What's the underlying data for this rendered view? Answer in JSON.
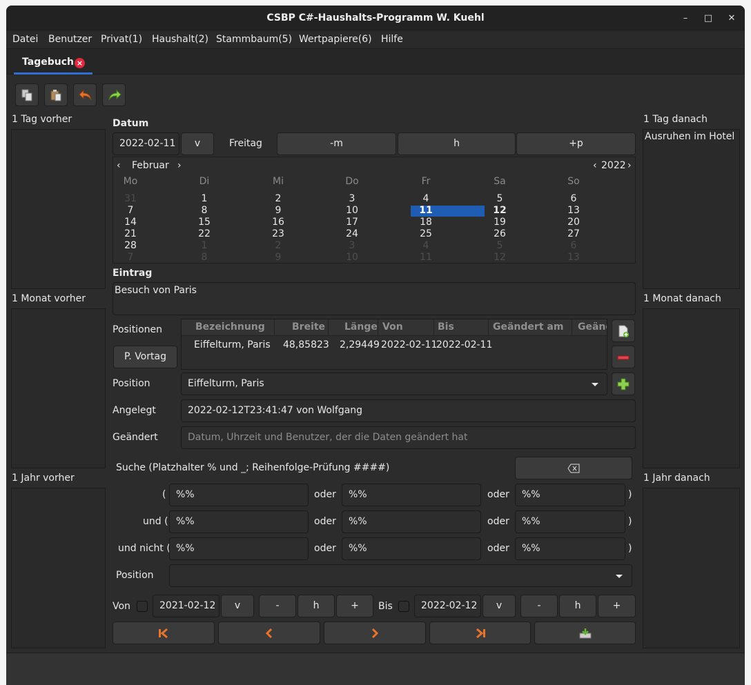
{
  "window": {
    "title": "CSBP C#-Haushalts-Programm W. Kuehl",
    "minimize": "–",
    "maximize": "□",
    "close": "✕"
  },
  "menu": [
    "Datei",
    "Benutzer",
    "Privat(1)",
    "Haushalt(2)",
    "Stammbaum(5)",
    "Wertpapiere(6)",
    "Hilfe"
  ],
  "tab": {
    "label": "Tagebuch",
    "close": "×"
  },
  "toolbar": {
    "icons": [
      "copy-icon",
      "paste-icon",
      "undo-icon",
      "redo-icon"
    ]
  },
  "left": {
    "day_label": "1 Tag vorher",
    "day_text": "",
    "month_label": "1 Monat vorher",
    "month_text": "",
    "year_label": "1 Jahr vorher",
    "year_text": ""
  },
  "right": {
    "day_label": "1 Tag danach",
    "day_text": "Ausruhen im Hotel",
    "month_label": "1 Monat danach",
    "month_text": "",
    "year_label": "1 Jahr danach",
    "year_text": ""
  },
  "datum": {
    "label": "Datum",
    "value": "2022-02-11",
    "v_button": "v",
    "weekday": "Freitag",
    "minus_m": "-m",
    "h_button": "h",
    "plus_p": "+p"
  },
  "calendar": {
    "month": "Februar",
    "year": "2022",
    "prev": "‹",
    "next": "›",
    "weekdays": [
      "Mo",
      "Di",
      "Mi",
      "Do",
      "Fr",
      "Sa",
      "So"
    ],
    "weeks": [
      [
        "31",
        "1",
        "2",
        "3",
        "4",
        "5",
        "6"
      ],
      [
        "7",
        "8",
        "9",
        "10",
        "11",
        "12",
        "13"
      ],
      [
        "14",
        "15",
        "16",
        "17",
        "18",
        "19",
        "20"
      ],
      [
        "21",
        "22",
        "23",
        "24",
        "25",
        "26",
        "27"
      ],
      [
        "28",
        "1",
        "2",
        "3",
        "4",
        "5",
        "6"
      ],
      [
        "7",
        "8",
        "9",
        "10",
        "11",
        "12",
        "13"
      ]
    ],
    "selected": "11",
    "accent": "#1f5db5"
  },
  "eintrag": {
    "label": "Eintrag",
    "value": "Besuch von Paris"
  },
  "positionen": {
    "label": "Positionen",
    "vortag_button": "P. Vortag",
    "columns": [
      "Bezeichnung",
      "Breite",
      "Länge",
      "Von",
      "Bis",
      "Geändert am",
      "Geänd"
    ],
    "rows": [
      [
        "Eiffelturm, Paris",
        "48,85823",
        "2,29449",
        "2022-02-11",
        "2022-02-11",
        "",
        ""
      ]
    ]
  },
  "position": {
    "label": "Position",
    "value": "Eiffelturm, Paris"
  },
  "angelegt": {
    "label": "Angelegt",
    "value": "2022-02-12T23:41:47 von Wolfgang"
  },
  "geaendert": {
    "label": "Geändert",
    "placeholder": "Datum, Uhrzeit und Benutzer, der die Daten geändert hat"
  },
  "suche": {
    "label": "Suche (Platzhalter % und _; Reihenfolge-Prüfung ####)",
    "clear_icon": "backspace-icon",
    "row1_prefix": "(",
    "row2_prefix": "und (",
    "row3_prefix": "und nicht (",
    "oder": "oder",
    "suffix": ")",
    "values": [
      [
        "%%",
        "%%",
        "%%"
      ],
      [
        "%%",
        "%%",
        "%%"
      ],
      [
        "%%",
        "%%",
        "%%"
      ]
    ],
    "position_label": "Position",
    "position_value": ""
  },
  "range": {
    "von_label": "Von",
    "von_value": "2021-02-12",
    "bis_label": "Bis",
    "bis_value": "2022-02-12",
    "v": "v",
    "minus": "-",
    "h": "h",
    "plus": "+"
  },
  "nav": {
    "icons": [
      "first-icon",
      "previous-icon",
      "next-icon",
      "last-icon",
      "export-icon"
    ],
    "accent": "#e8742a"
  }
}
